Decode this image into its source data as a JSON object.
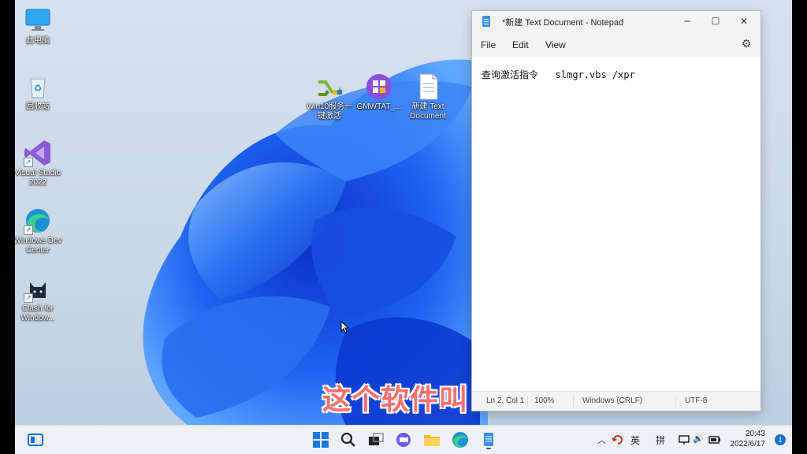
{
  "desktop": {
    "icons": [
      {
        "label": "此电脑"
      },
      {
        "label": "回收站"
      },
      {
        "label": "Visual Studio 2022"
      },
      {
        "label": "Windows Dev Center"
      },
      {
        "label": "Clash for Window..."
      },
      {
        "label": "Win10服务一键激活"
      },
      {
        "label": "GMWTAT_..."
      },
      {
        "label": "新建 Text Document"
      }
    ]
  },
  "notepad": {
    "title": "*新建 Text Document - Notepad",
    "menu": [
      "File",
      "Edit",
      "View"
    ],
    "content": "查询激活指令   slmgr.vbs /xpr",
    "status": {
      "position": "Ln 2, Col 1",
      "zoom": "100%",
      "line_ending": "Windows (CRLF)",
      "encoding": "UTF-8"
    }
  },
  "subtitle": "这个软件叫",
  "taskbar": {
    "tray_lang": "英",
    "tray_ime": "拼",
    "time": "20:43",
    "date": "2022/6/17",
    "notifications": "1"
  },
  "colors": {
    "accent": "#1a6fd6",
    "subtitle": "#ff6e6e"
  }
}
